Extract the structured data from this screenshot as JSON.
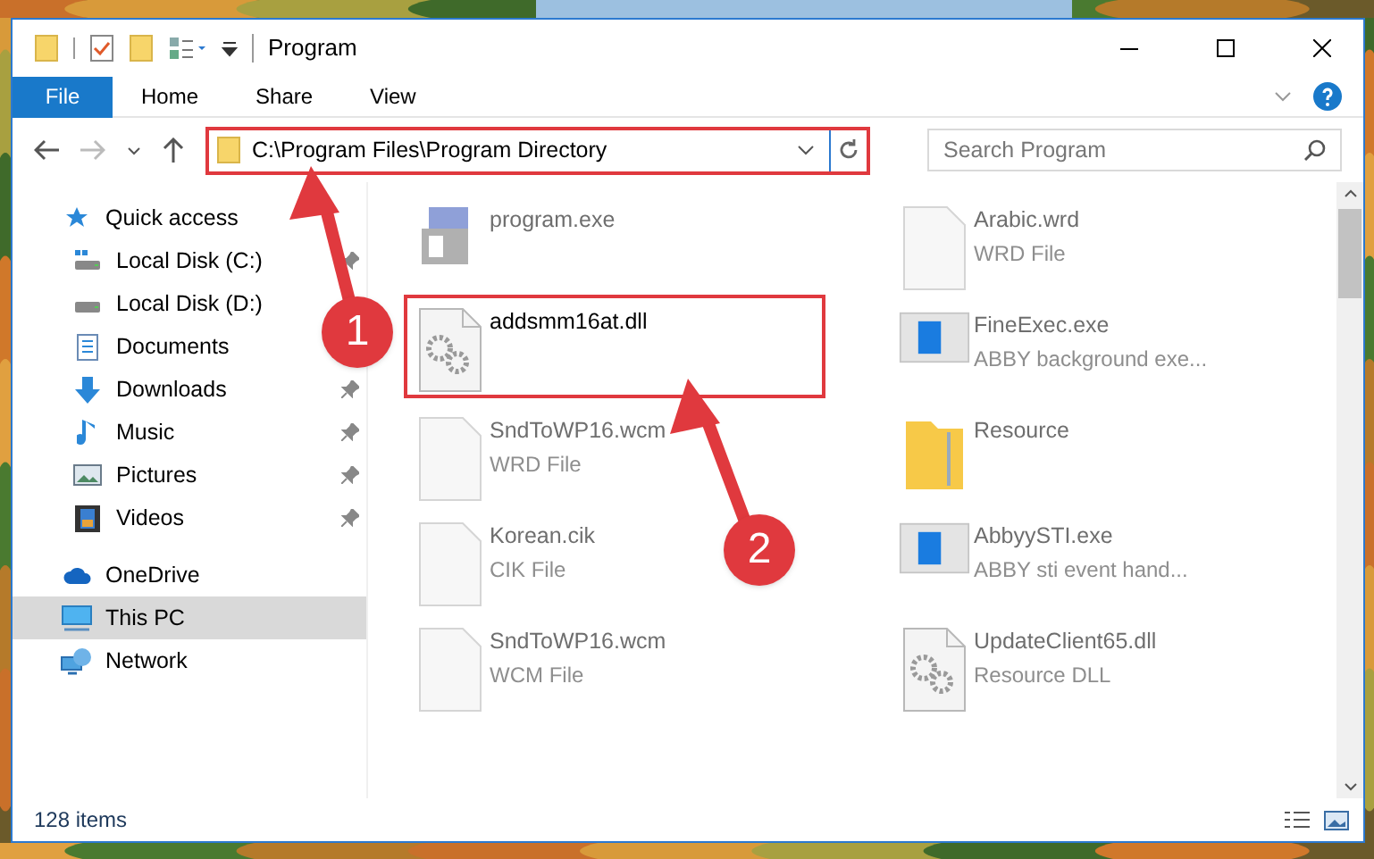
{
  "window": {
    "title": "Program"
  },
  "ribbon": {
    "tabs": [
      {
        "label": "File",
        "selected": true
      },
      {
        "label": "Home",
        "selected": false
      },
      {
        "label": "Share",
        "selected": false
      },
      {
        "label": "View",
        "selected": false
      }
    ]
  },
  "address": {
    "path": "C:\\Program Files\\Program Directory",
    "annotated": true
  },
  "search": {
    "placeholder": "Search Program"
  },
  "sidebar": {
    "items": [
      {
        "label": "Quick access",
        "kind": "star",
        "selected": false,
        "children": [
          {
            "label": "Local Disk (C:)",
            "kind": "drive-c",
            "pinned": true
          },
          {
            "label": "Local Disk (D:)",
            "kind": "drive"
          },
          {
            "label": "Documents",
            "kind": "documents"
          },
          {
            "label": "Downloads",
            "kind": "downloads",
            "pinned": true
          },
          {
            "label": "Music",
            "kind": "music",
            "pinned": true
          },
          {
            "label": "Pictures",
            "kind": "pictures",
            "pinned": true
          },
          {
            "label": "Videos",
            "kind": "videos",
            "pinned": true
          }
        ]
      },
      {
        "label": "OneDrive",
        "kind": "cloud",
        "selected": false
      },
      {
        "label": "This PC",
        "kind": "pc",
        "selected": true
      },
      {
        "label": "Network",
        "kind": "network",
        "selected": false
      }
    ]
  },
  "files": [
    {
      "name": "program.exe",
      "kind": "installer",
      "annotated": false
    },
    {
      "name": "Arabic.wrd",
      "type": "WRD File",
      "kind": "file",
      "annotated": false
    },
    {
      "name": "addsmm16at.dll",
      "kind": "dll",
      "annotated": true
    },
    {
      "name": "FineExec.exe",
      "type": "ABBY background exe...",
      "kind": "app",
      "annotated": false
    },
    {
      "name": "SndToWP16.wcm",
      "type": "WRD File",
      "kind": "file",
      "annotated": false
    },
    {
      "name": "Resource",
      "kind": "folder",
      "annotated": false
    },
    {
      "name": "Korean.cik",
      "type": "CIK File",
      "kind": "file",
      "annotated": false
    },
    {
      "name": "AbbyySTI.exe",
      "type": "ABBY sti event hand...",
      "kind": "app",
      "annotated": false
    },
    {
      "name": "SndToWP16.wcm",
      "type": "WCM File",
      "kind": "file",
      "annotated": false
    },
    {
      "name": "UpdateClient65.dll",
      "type": "Resource DLL",
      "kind": "dll",
      "annotated": false
    }
  ],
  "status_bar": {
    "count": "128 items"
  },
  "annotations": [
    {
      "number": "1"
    },
    {
      "number": "2"
    }
  ]
}
